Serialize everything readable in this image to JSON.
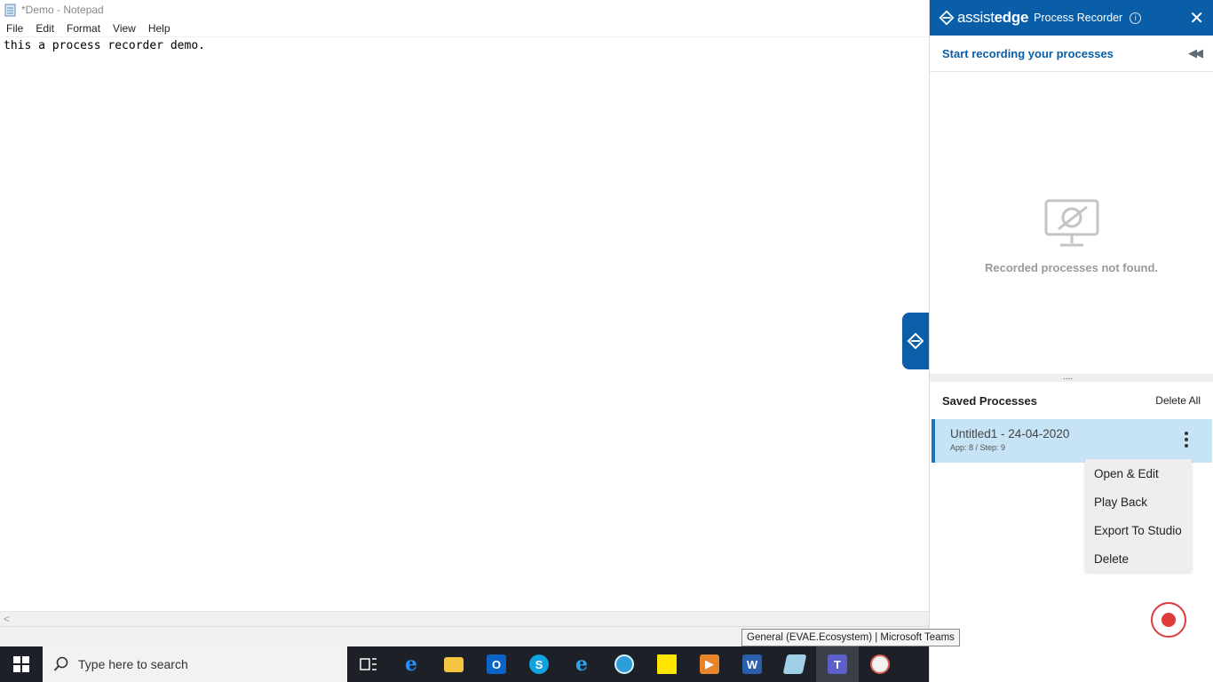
{
  "notepad": {
    "title": "*Demo - Notepad",
    "menu": [
      "File",
      "Edit",
      "Format",
      "View",
      "Help"
    ],
    "content": "this a process recorder demo."
  },
  "recorder": {
    "logo_assist": "assist",
    "logo_edge": "edge",
    "title": "Process Recorder",
    "info_glyph": "i",
    "close_glyph": "✕",
    "subtitle": "Start recording your processes",
    "collapse_glyph": "◀◀",
    "empty_text": "Recorded processes not found.",
    "divider_grip": "....",
    "saved_label": "Saved Processes",
    "delete_all_label": "Delete All",
    "items": [
      {
        "name": "Untitled1 - 24-04-2020",
        "meta": "App: 8 / Step: 9"
      }
    ],
    "context_menu": [
      "Open & Edit",
      "Play Back",
      "Export To Studio",
      "Delete"
    ],
    "colors": {
      "header": "#0a5ea8",
      "selected_item": "#c7e3f6",
      "record": "#e03a3a"
    }
  },
  "tooltip": "General (EVAE.Ecosystem) | Microsoft Teams",
  "taskbar": {
    "search_placeholder": "Type here to search",
    "icons": [
      "task-view-icon",
      "edge-icon",
      "file-explorer-icon",
      "outlook-icon",
      "skype-icon",
      "internet-explorer-icon",
      "browser-icon",
      "sticky-notes-icon",
      "media-player-icon",
      "word-icon",
      "notepad-icon",
      "teams-icon",
      "paint-icon"
    ]
  }
}
